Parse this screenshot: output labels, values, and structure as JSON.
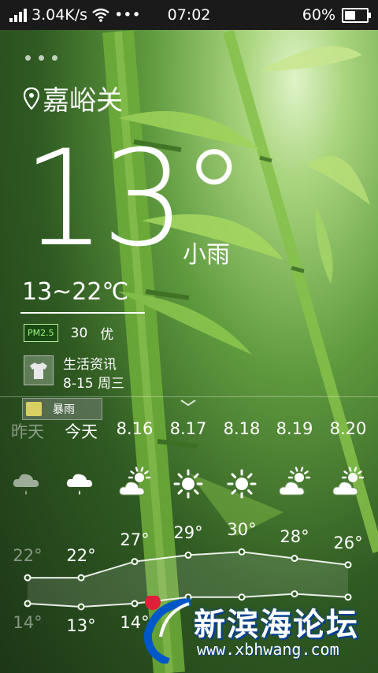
{
  "status_bar": {
    "net_speed": "3.04K/s",
    "more": "•••",
    "time": "07:02",
    "battery_percent": "60%",
    "battery_level": 0.6
  },
  "weather": {
    "city": "嘉峪关",
    "current_temp": "13°",
    "condition": "小雨",
    "range": "13~22℃",
    "pm_label": "PM2.5",
    "pm_value": "30",
    "pm_quality": "优",
    "life_title": "生活资讯",
    "life_date": "8-15 周三",
    "alert": "暴雨"
  },
  "forecast": [
    {
      "day": "昨天",
      "icon": "cloud-rain-icon",
      "high": "22°",
      "low": "14°",
      "past": true
    },
    {
      "day": "今天",
      "icon": "cloud-rain-icon",
      "high": "22°",
      "low": "13°",
      "past": false
    },
    {
      "day": "8.16",
      "icon": "partly-sunny-icon",
      "high": "27°",
      "low": "14°",
      "past": false
    },
    {
      "day": "8.17",
      "icon": "sun-icon",
      "high": "29°",
      "low": "",
      "past": false
    },
    {
      "day": "8.18",
      "icon": "sun-icon",
      "high": "30°",
      "low": "",
      "past": false
    },
    {
      "day": "8.19",
      "icon": "partly-sunny-icon",
      "high": "28°",
      "low": "",
      "past": false
    },
    {
      "day": "8.20",
      "icon": "partly-sunny-icon",
      "high": "26°",
      "low": "",
      "past": false
    }
  ],
  "chart_data": {
    "type": "line",
    "categories": [
      "昨天",
      "今天",
      "8.16",
      "8.17",
      "8.18",
      "8.19",
      "8.20"
    ],
    "series": [
      {
        "values": [
          22,
          22,
          27,
          29,
          30,
          28,
          26
        ]
      },
      {
        "values": [
          14,
          13,
          14,
          16,
          16,
          17,
          16
        ]
      }
    ]
  },
  "watermark": {
    "title": "新滨海论坛",
    "url": "www.xbhwang.com"
  },
  "colors": {
    "accent_green": "#9ef57a",
    "watermark_blue": "#003e9a",
    "watermark_red": "#e0203a"
  }
}
